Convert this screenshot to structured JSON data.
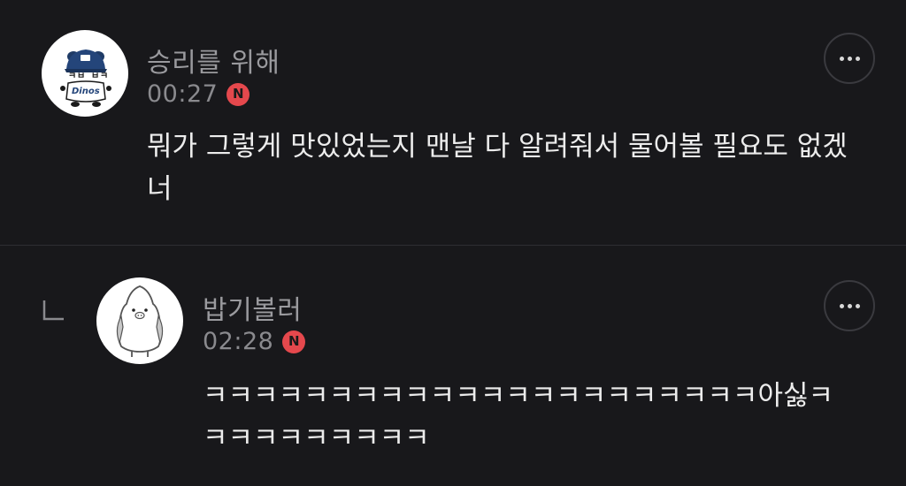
{
  "comments": [
    {
      "nickname": "승리를 위해",
      "time": "00:27",
      "badge": "N",
      "text": "뭐가 그렇게 맛있었는지 맨날 다 알려줘서 물어볼 필요도 없겠너",
      "avatar_icon": "dinos-mascot-avatar",
      "is_reply": false
    },
    {
      "nickname": "밥기볼러",
      "time": "02:28",
      "badge": "N",
      "text": "ㅋㅋㅋㅋㅋㅋㅋㅋㅋㅋㅋㅋㅋㅋㅋㅋㅋㅋㅋㅋㅋㅋ아싫ㅋㅋㅋㅋㅋㅋㅋㅋㅋㅋ",
      "avatar_icon": "penguin-avatar",
      "is_reply": true
    }
  ],
  "avatar_text": "Dinos",
  "icons": {
    "more": "more-horizontal-icon",
    "reply": "reply-arrow-icon"
  },
  "colors": {
    "background": "#18181b",
    "badge": "#e5484d",
    "nickname": "#9a9a9e",
    "text": "#ececec",
    "divider": "#2e2e32"
  }
}
